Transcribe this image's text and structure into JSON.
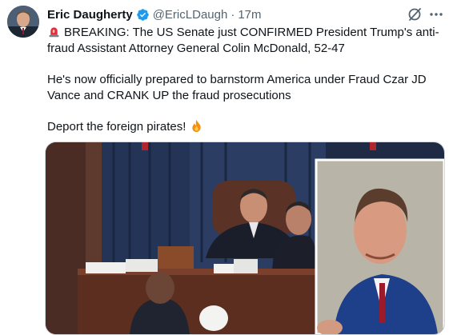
{
  "tweet": {
    "author_name": "Eric Daugherty",
    "handle": "@EricLDaugh",
    "separator": "·",
    "time": "17m",
    "paragraphs": [
      "BREAKING: The US Senate just CONFIRMED President Trump's anti-fraud Assistant Attorney General Colin McDonald, 52-47",
      "He's now officially prepared to barnstorm America under Fraud Czar JD Vance and CRANK UP the fraud prosecutions",
      "Deport the foreign pirates!"
    ]
  },
  "icons": {
    "verified": "verified-badge-icon",
    "grok": "grok-icon",
    "more": "more-options-icon",
    "siren": "siren-emoji",
    "fire": "fire-emoji"
  },
  "colors": {
    "text": "#0f1419",
    "muted": "#536471",
    "verified_blue": "#1d9bf0",
    "border": "#cfd9de"
  }
}
